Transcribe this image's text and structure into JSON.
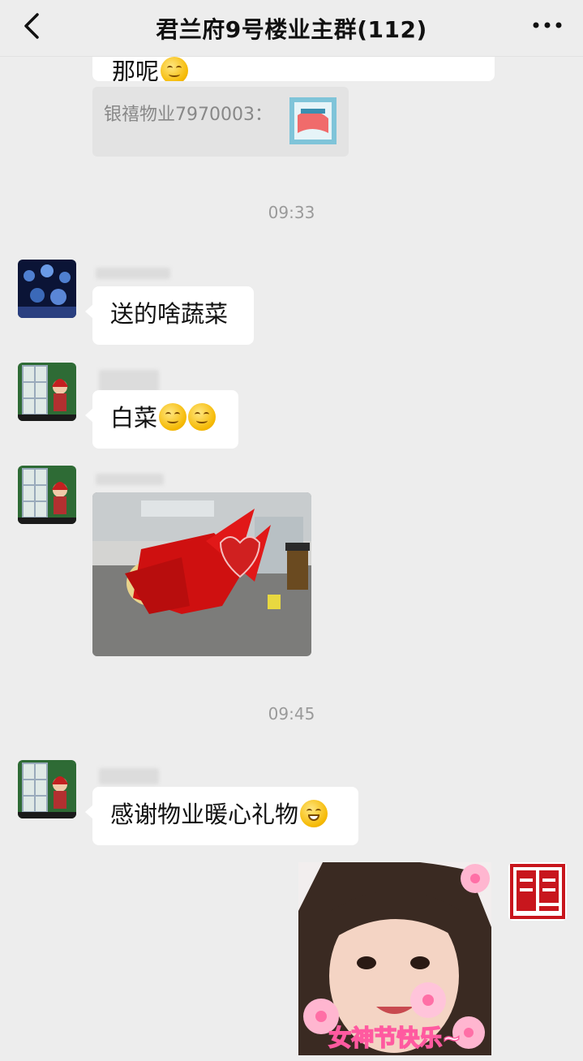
{
  "header": {
    "title": "君兰府9号楼业主群(112)"
  },
  "messages": {
    "partial_text": "那呢",
    "quote_text": "银禧物业7970003：",
    "time1": "09:33",
    "msg1": "送的啥蔬菜",
    "msg2": "白菜",
    "time2": "09:45",
    "msg3": "感谢物业暖心礼物",
    "sticker_caption": "女神节快乐~"
  },
  "icons": {
    "back": "chevron-left-icon",
    "more": "more-dots-icon",
    "emoji_smile": "smile-emoji-icon",
    "emoji_grin": "grin-emoji-icon"
  },
  "colors": {
    "background": "#ededed",
    "bubble": "#ffffff",
    "quote": "#e3e3e3",
    "time": "#9a9a9a",
    "sticker_text": "#ff5aa0"
  }
}
